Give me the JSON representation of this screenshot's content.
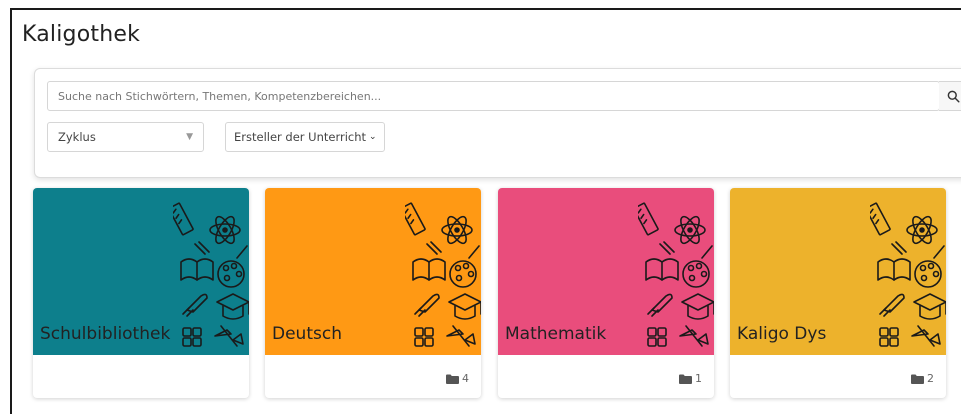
{
  "page": {
    "title": "Kaligothek"
  },
  "search": {
    "placeholder": "Suche nach Stichwörtern, Themen, Kompetenzbereichen..."
  },
  "filters": {
    "zyklus": "Zyklus",
    "ersteller": "Ersteller der Unterricht"
  },
  "cards": [
    {
      "title": "Schulbibliothek",
      "color": "#0d7f8c",
      "count": ""
    },
    {
      "title": "Deutsch",
      "color": "#ff9914",
      "count": "4"
    },
    {
      "title": "Mathematik",
      "color": "#e94d7c",
      "count": "1"
    },
    {
      "title": "Kaligo Dys",
      "color": "#edb22c",
      "count": "2"
    }
  ],
  "icons": {
    "search": "search-icon",
    "folder": "folder-icon",
    "doodles": "school-supplies-doodle-icon"
  }
}
